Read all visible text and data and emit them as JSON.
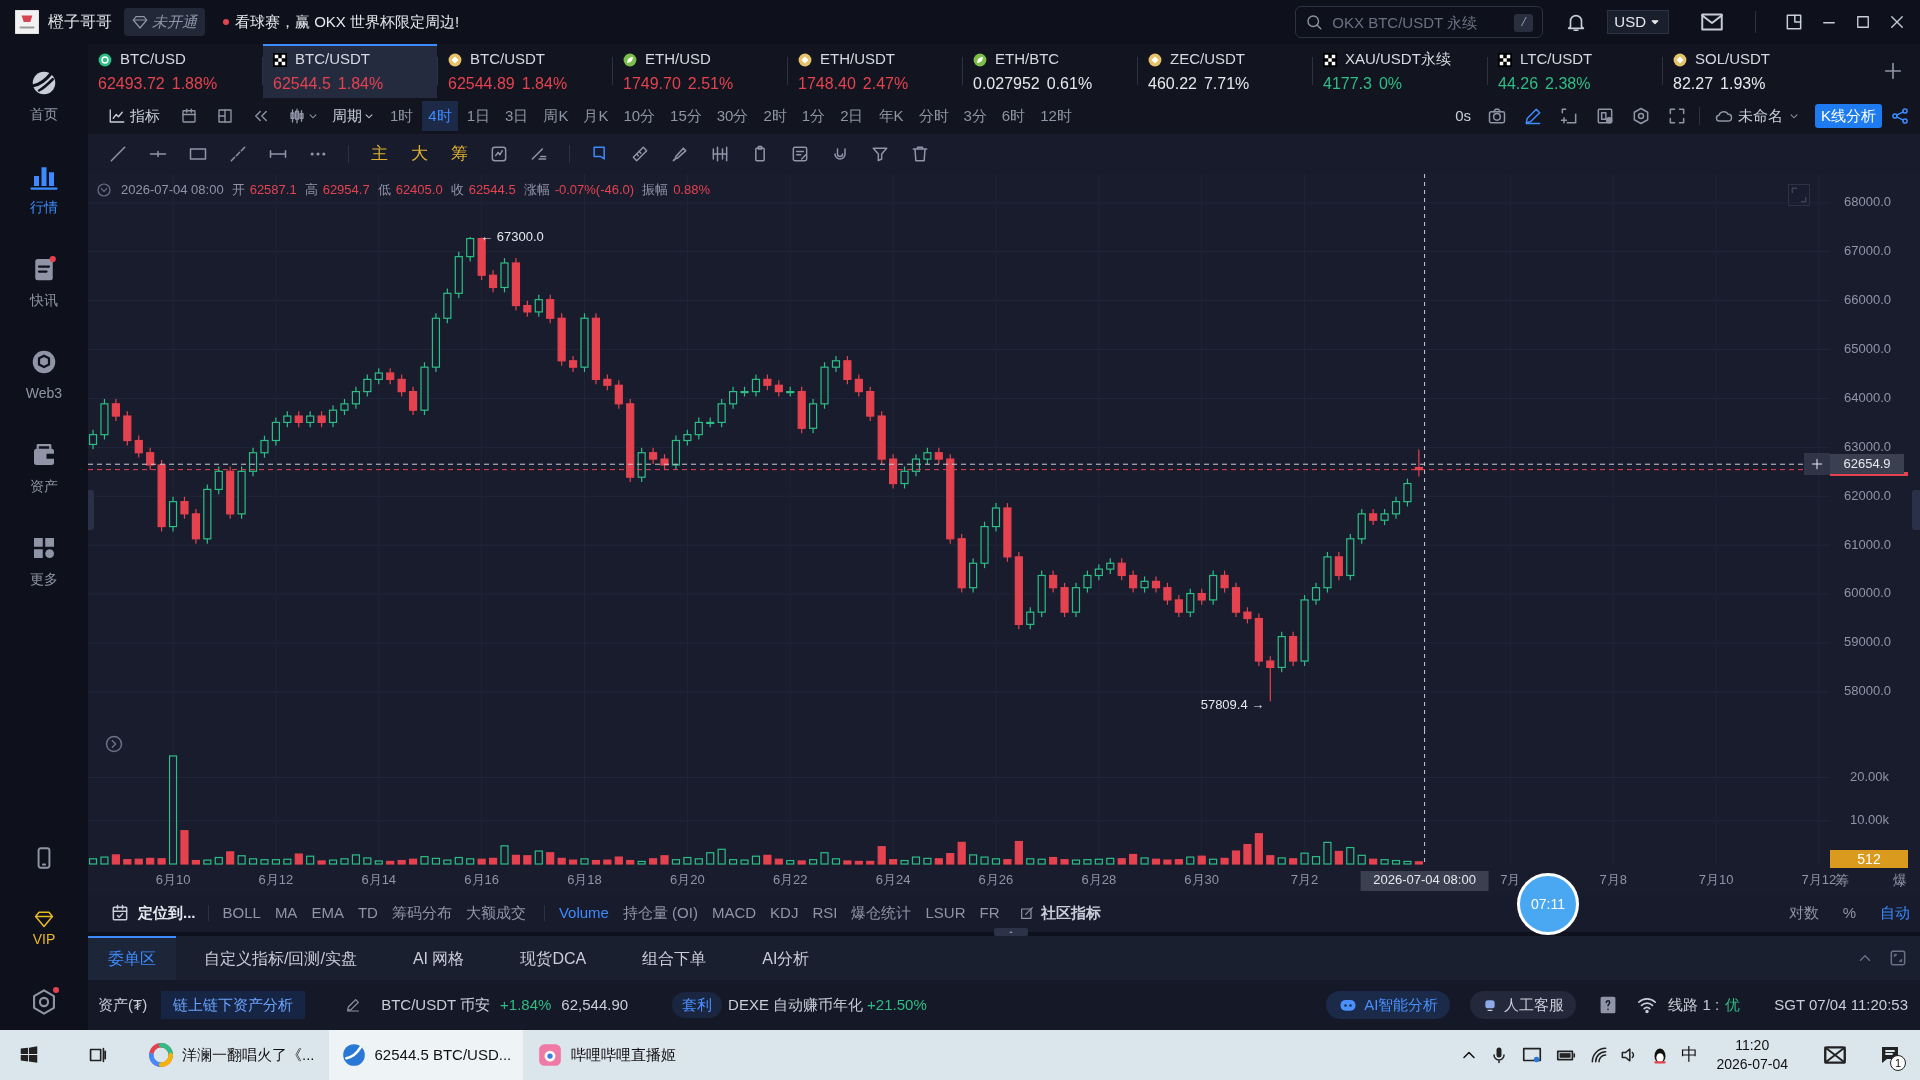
{
  "title_bar": {
    "app_name": "橙子哥哥",
    "membership": "未开通",
    "promo": "看球赛，赢 OKX 世界杯限定周边!",
    "search": {
      "placeholder": "OKX BTC/USDT 永续",
      "shortcut": "/"
    },
    "currency": "USD"
  },
  "sidebar": {
    "items": [
      {
        "label": "首页",
        "kind": "home",
        "selected": false
      },
      {
        "label": "行情",
        "kind": "market",
        "selected": true
      },
      {
        "label": "快讯",
        "kind": "news",
        "selected": false
      },
      {
        "label": "Web3",
        "kind": "web3",
        "selected": false
      },
      {
        "label": "资产",
        "kind": "assets",
        "selected": false
      },
      {
        "label": "更多",
        "kind": "more",
        "selected": false
      }
    ],
    "vip": "VIP"
  },
  "tickers": [
    {
      "symbol": "BTC/USD",
      "kind": "bitcoin",
      "price": "62493.72",
      "change": "1.88%",
      "color": "#e5424f",
      "selected": false
    },
    {
      "symbol": "BTC/USDT",
      "kind": "okx",
      "price": "62544.5",
      "change": "1.84%",
      "color": "#e5424f",
      "selected": true
    },
    {
      "symbol": "BTC/USDT",
      "kind": "binance",
      "price": "62544.89",
      "change": "1.84%",
      "color": "#e5424f",
      "selected": false
    },
    {
      "symbol": "ETH/USD",
      "kind": "leaf",
      "price": "1749.70",
      "change": "2.51%",
      "color": "#e5424f",
      "selected": false
    },
    {
      "symbol": "ETH/USDT",
      "kind": "binance",
      "price": "1748.40",
      "change": "2.47%",
      "color": "#e5424f",
      "selected": false
    },
    {
      "symbol": "ETH/BTC",
      "kind": "leaf",
      "price": "0.027952",
      "change": "0.61%",
      "color": "#e6e8ee",
      "selected": false
    },
    {
      "symbol": "ZEC/USDT",
      "kind": "binance",
      "price": "460.22",
      "change": "7.71%",
      "color": "#e6e8ee",
      "selected": false
    },
    {
      "symbol": "XAU/USDT永续",
      "kind": "okx",
      "price": "4177.3",
      "change": "0%",
      "color": "#2ebd85",
      "selected": false
    },
    {
      "symbol": "LTC/USDT",
      "kind": "okx",
      "price": "44.26",
      "change": "2.38%",
      "color": "#2ebd85",
      "selected": false
    },
    {
      "symbol": "SOL/USDT",
      "kind": "binance",
      "price": "82.27",
      "change": "1.93%",
      "color": "#e6e8ee",
      "selected": false
    }
  ],
  "period_bar": {
    "indicator_button": "指标",
    "period_button": "周期",
    "periods": [
      {
        "label": "1时",
        "selected": false
      },
      {
        "label": "4时",
        "selected": true
      },
      {
        "label": "1日",
        "selected": false
      },
      {
        "label": "3日",
        "selected": false
      },
      {
        "label": "周K",
        "selected": false
      },
      {
        "label": "月K",
        "selected": false
      },
      {
        "label": "10分",
        "selected": false
      },
      {
        "label": "15分",
        "selected": false
      },
      {
        "label": "30分",
        "selected": false
      },
      {
        "label": "2时",
        "selected": false
      },
      {
        "label": "1分",
        "selected": false
      },
      {
        "label": "2日",
        "selected": false
      },
      {
        "label": "年K",
        "selected": false
      },
      {
        "label": "分时",
        "selected": false
      },
      {
        "label": "3分",
        "selected": false
      },
      {
        "label": "6时",
        "selected": false
      },
      {
        "label": "12时",
        "selected": false
      }
    ],
    "timer": "0s",
    "layout_name": "未命名",
    "analysis_button": "K线分析"
  },
  "text_tools": [
    "主",
    "大",
    "筹"
  ],
  "ohlc_info": {
    "time": "2026-07-04 08:00",
    "fields": [
      {
        "label": "开",
        "value": "62587.1"
      },
      {
        "label": "高",
        "value": "62954.7"
      },
      {
        "label": "低",
        "value": "62405.0"
      },
      {
        "label": "收",
        "value": "62544.5"
      },
      {
        "label": "涨幅",
        "value": "-0.07%(-46.0)"
      },
      {
        "label": "振幅",
        "value": "0.88%"
      }
    ]
  },
  "price_chart": {
    "chart_data": {
      "type": "candlestick",
      "grid": true,
      "ylim": [
        57220,
        68590
      ],
      "yticks": [
        {
          "value": 58000,
          "label": "58000.0"
        },
        {
          "value": 59000,
          "label": "59000.0"
        },
        {
          "value": 60000,
          "label": "60000.0"
        },
        {
          "value": 61000,
          "label": "61000.0"
        },
        {
          "value": 62000,
          "label": "62000.0"
        },
        {
          "value": 63000,
          "label": "63000.0"
        },
        {
          "value": 64000,
          "label": "64000.0"
        },
        {
          "value": 65000,
          "label": "65000.0"
        },
        {
          "value": 66000,
          "label": "66000.0"
        },
        {
          "value": 67000,
          "label": "67000.0"
        },
        {
          "value": 68000,
          "label": "68000.0"
        }
      ],
      "ohlc": [
        [
          63060,
          63360,
          62960,
          63260
        ],
        [
          63260,
          63990,
          63160,
          63890
        ],
        [
          63890,
          63990,
          63540,
          63640
        ],
        [
          63640,
          63740,
          63040,
          63140
        ],
        [
          63140,
          63240,
          62790,
          62890
        ],
        [
          62890,
          62990,
          62540,
          62640
        ],
        [
          62640,
          62740,
          61280,
          61380
        ],
        [
          61380,
          61990,
          61280,
          61890
        ],
        [
          61890,
          61990,
          61540,
          61640
        ],
        [
          61640,
          61740,
          61030,
          61130
        ],
        [
          61130,
          62240,
          61030,
          62140
        ],
        [
          62140,
          62610,
          62040,
          62510
        ],
        [
          62510,
          62610,
          61540,
          61640
        ],
        [
          61640,
          62610,
          61540,
          62510
        ],
        [
          62510,
          62990,
          62410,
          62890
        ],
        [
          62890,
          63240,
          62790,
          63140
        ],
        [
          63140,
          63610,
          63040,
          63510
        ],
        [
          63510,
          63740,
          63410,
          63640
        ],
        [
          63640,
          63740,
          63410,
          63510
        ],
        [
          63510,
          63740,
          63410,
          63640
        ],
        [
          63640,
          63740,
          63410,
          63510
        ],
        [
          63510,
          63860,
          63410,
          63760
        ],
        [
          63760,
          63990,
          63660,
          63890
        ],
        [
          63890,
          64240,
          63790,
          64140
        ],
        [
          64140,
          64490,
          64040,
          64390
        ],
        [
          64390,
          64620,
          64290,
          64520
        ],
        [
          64520,
          64620,
          64290,
          64390
        ],
        [
          64390,
          64490,
          64040,
          64140
        ],
        [
          64140,
          64240,
          63660,
          63760
        ],
        [
          63760,
          64740,
          63660,
          64640
        ],
        [
          64640,
          65740,
          64540,
          65640
        ],
        [
          65640,
          66250,
          65540,
          66150
        ],
        [
          66150,
          67000,
          66050,
          66900
        ],
        [
          66900,
          67300,
          66800,
          67270
        ],
        [
          67270,
          67290,
          66420,
          66520
        ],
        [
          66520,
          66620,
          66170,
          66270
        ],
        [
          66270,
          66870,
          66170,
          66770
        ],
        [
          66770,
          66870,
          65800,
          65900
        ],
        [
          65900,
          66000,
          65670,
          65770
        ],
        [
          65770,
          66120,
          65670,
          66020
        ],
        [
          66020,
          66120,
          65540,
          65640
        ],
        [
          65640,
          65740,
          64670,
          64770
        ],
        [
          64770,
          64870,
          64540,
          64640
        ],
        [
          64640,
          65740,
          64540,
          65640
        ],
        [
          65640,
          65740,
          64290,
          64390
        ],
        [
          64390,
          64490,
          64170,
          64270
        ],
        [
          64270,
          64370,
          63790,
          63890
        ],
        [
          63890,
          63990,
          62290,
          62390
        ],
        [
          62390,
          62990,
          62290,
          62890
        ],
        [
          62890,
          62990,
          62660,
          62760
        ],
        [
          62760,
          62860,
          62540,
          62640
        ],
        [
          62640,
          63240,
          62540,
          63140
        ],
        [
          63140,
          63360,
          63040,
          63260
        ],
        [
          63260,
          63610,
          63160,
          63510
        ],
        [
          63510,
          63610,
          63410,
          63510
        ],
        [
          63510,
          63990,
          63410,
          63890
        ],
        [
          63890,
          64240,
          63790,
          64140
        ],
        [
          64140,
          64240,
          64040,
          64140
        ],
        [
          64140,
          64490,
          64040,
          64390
        ],
        [
          64390,
          64490,
          64170,
          64270
        ],
        [
          64270,
          64370,
          64040,
          64140
        ],
        [
          64140,
          64240,
          64040,
          64140
        ],
        [
          64140,
          64240,
          63290,
          63390
        ],
        [
          63390,
          63990,
          63290,
          63890
        ],
        [
          63890,
          64740,
          63790,
          64640
        ],
        [
          64640,
          64870,
          64540,
          64770
        ],
        [
          64770,
          64870,
          64290,
          64390
        ],
        [
          64390,
          64490,
          64040,
          64140
        ],
        [
          64140,
          64240,
          63540,
          63640
        ],
        [
          63640,
          63740,
          62660,
          62760
        ],
        [
          62760,
          62860,
          62160,
          62260
        ],
        [
          62260,
          62610,
          62160,
          62510
        ],
        [
          62510,
          62860,
          62410,
          62760
        ],
        [
          62760,
          62990,
          62660,
          62890
        ],
        [
          62890,
          62990,
          62660,
          62760
        ],
        [
          62760,
          62860,
          61030,
          61130
        ],
        [
          61130,
          61230,
          60030,
          60130
        ],
        [
          60130,
          60730,
          60030,
          60630
        ],
        [
          60630,
          61480,
          60530,
          61380
        ],
        [
          61380,
          61860,
          61280,
          61760
        ],
        [
          61760,
          61860,
          60660,
          60760
        ],
        [
          60760,
          60860,
          59280,
          59380
        ],
        [
          59380,
          59730,
          59280,
          59630
        ],
        [
          59630,
          60480,
          59530,
          60380
        ],
        [
          60380,
          60480,
          60030,
          60130
        ],
        [
          60130,
          60230,
          59530,
          59630
        ],
        [
          59630,
          60230,
          59530,
          60130
        ],
        [
          60130,
          60480,
          60030,
          60380
        ],
        [
          60380,
          60610,
          60280,
          60510
        ],
        [
          60510,
          60730,
          60410,
          60630
        ],
        [
          60630,
          60730,
          60280,
          60380
        ],
        [
          60380,
          60480,
          60030,
          60130
        ],
        [
          60130,
          60360,
          60030,
          60260
        ],
        [
          60260,
          60360,
          60030,
          60130
        ],
        [
          60130,
          60230,
          59780,
          59880
        ],
        [
          59880,
          59980,
          59530,
          59630
        ],
        [
          59630,
          60110,
          59530,
          60010
        ],
        [
          60010,
          60110,
          59780,
          59880
        ],
        [
          59880,
          60480,
          59780,
          60380
        ],
        [
          60380,
          60480,
          60030,
          60130
        ],
        [
          60130,
          60230,
          59530,
          59630
        ],
        [
          59630,
          59730,
          59400,
          59500
        ],
        [
          59500,
          59600,
          58530,
          58630
        ],
        [
          58630,
          58730,
          57809.4,
          58500
        ],
        [
          58500,
          59230,
          58400,
          59130
        ],
        [
          59130,
          59230,
          58530,
          58630
        ],
        [
          58630,
          59980,
          58530,
          59880
        ],
        [
          59880,
          60230,
          59780,
          60130
        ],
        [
          60130,
          60860,
          60030,
          60760
        ],
        [
          60760,
          60860,
          60280,
          60380
        ],
        [
          60380,
          61230,
          60280,
          61130
        ],
        [
          61130,
          61740,
          61030,
          61640
        ],
        [
          61640,
          61740,
          61410,
          61510
        ],
        [
          61510,
          61740,
          61410,
          61640
        ],
        [
          61640,
          61990,
          61540,
          61890
        ],
        [
          61890,
          62360,
          61790,
          62260
        ],
        [
          62587.1,
          62954.7,
          62405,
          62544.5
        ],
        null,
        null,
        null,
        null,
        null,
        null,
        null,
        null,
        null,
        null,
        null,
        null,
        null,
        null,
        null,
        null,
        null,
        null,
        null,
        null,
        null,
        null,
        null,
        null,
        null,
        null,
        null,
        null,
        null,
        null,
        null,
        null,
        null,
        null,
        null
      ],
      "ref_lines": [
        {
          "axis": "y",
          "value": 62544.5,
          "color": "#e5424f"
        },
        {
          "axis": "y",
          "value": 62654.9,
          "color": "#c9cdd8"
        }
      ],
      "annotations": [
        "← 67300.0",
        "57809.4 →"
      ]
    },
    "crosshair_price": "62654.9"
  },
  "volume_chart": {
    "chart_data": {
      "type": "bar",
      "grid": true,
      "ylim": [
        0,
        31
      ],
      "categories": [
        null,
        null,
        null,
        null,
        null,
        null,
        null,
        "6月10",
        null,
        null,
        null,
        null,
        null,
        null,
        null,
        null,
        "6月12",
        null,
        null,
        null,
        null,
        null,
        null,
        null,
        null,
        "6月14",
        null,
        null,
        null,
        null,
        null,
        null,
        null,
        null,
        "6月16",
        null,
        null,
        null,
        null,
        null,
        null,
        null,
        null,
        "6月18",
        null,
        null,
        null,
        null,
        null,
        null,
        null,
        null,
        "6月20",
        null,
        null,
        null,
        null,
        null,
        null,
        null,
        null,
        "6月22",
        null,
        null,
        null,
        null,
        null,
        null,
        null,
        null,
        "6月24",
        null,
        null,
        null,
        null,
        null,
        null,
        null,
        null,
        "6月26",
        null,
        null,
        null,
        null,
        null,
        null,
        null,
        null,
        "6月28",
        null,
        null,
        null,
        null,
        null,
        null,
        null,
        null,
        "6月30",
        null,
        null,
        null,
        null,
        null,
        null,
        null,
        null,
        "7月2",
        null,
        null,
        null,
        null,
        null,
        null,
        null,
        null,
        null,
        null,
        null,
        null,
        null,
        null,
        null,
        null,
        null,
        "7月",
        null,
        null,
        null,
        null,
        null,
        null,
        null,
        null,
        "7月8",
        null,
        null,
        null,
        null,
        null,
        null,
        null,
        null,
        "7月10",
        null,
        null,
        null,
        null,
        null,
        null,
        null,
        null,
        "7月12"
      ],
      "yticks": [
        {
          "value": 10,
          "label": "10.00k"
        },
        {
          "value": 20,
          "label": "20.00k"
        }
      ],
      "values": [
        1.2,
        1.6,
        2.1,
        1.0,
        1.1,
        1.3,
        1.2,
        25.0,
        7.7,
        0.8,
        0.9,
        1.5,
        2.8,
        1.9,
        1.2,
        1.0,
        1.0,
        1.1,
        2.3,
        1.8,
        0.7,
        0.9,
        1.2,
        2.1,
        1.4,
        0.7,
        0.6,
        0.8,
        1.1,
        1.7,
        1.3,
        0.9,
        1.5,
        1.2,
        1.1,
        1.3,
        4.2,
        2.0,
        1.9,
        3.0,
        2.6,
        1.3,
        0.9,
        1.2,
        0.8,
        0.9,
        1.6,
        0.8,
        0.6,
        1.2,
        1.9,
        1.0,
        1.5,
        1.2,
        2.6,
        3.4,
        1.0,
        0.9,
        1.8,
        2.0,
        1.1,
        0.8,
        0.7,
        1.0,
        2.6,
        1.2,
        0.7,
        0.6,
        0.6,
        4.0,
        1.0,
        0.8,
        1.6,
        1.3,
        1.2,
        2.4,
        5.0,
        2.1,
        1.6,
        1.2,
        1.0,
        5.2,
        1.2,
        1.1,
        1.5,
        1.0,
        0.9,
        1.0,
        1.1,
        1.3,
        1.2,
        2.2,
        1.4,
        1.1,
        0.9,
        1.0,
        1.6,
        1.8,
        1.1,
        1.3,
        3.0,
        4.5,
        7.0,
        1.9,
        1.4,
        1.2,
        2.5,
        1.7,
        5.0,
        2.9,
        3.8,
        2.0,
        1.1,
        1.0,
        0.8,
        0.6,
        0.5,
        null,
        null,
        null,
        null,
        null,
        null,
        null,
        null,
        null,
        null,
        null,
        null,
        null,
        null,
        null,
        null,
        null,
        null,
        null,
        null,
        null,
        null,
        null,
        null,
        null,
        null,
        null,
        null,
        null,
        null,
        null,
        null,
        null,
        null,
        null
      ]
    },
    "current_volume": "512",
    "crosshair_time": "2026-07-04 08:00",
    "axis_buttons": [
      "筹",
      "爆"
    ]
  },
  "clock_bubble": "07:11",
  "indicator_bar": {
    "locate_button": "定位到...",
    "main_indicators": [
      "BOLL",
      "MA",
      "EMA",
      "TD",
      "筹码分布",
      "大额成交"
    ],
    "sub_indicators": [
      {
        "label": "Volume",
        "selected": true
      },
      {
        "label": "持仓量 (OI)",
        "selected": false
      },
      {
        "label": "MACD",
        "selected": false
      },
      {
        "label": "KDJ",
        "selected": false
      },
      {
        "label": "RSI",
        "selected": false
      },
      {
        "label": "爆仓统计",
        "selected": false
      },
      {
        "label": "LSUR",
        "selected": false
      },
      {
        "label": "FR",
        "selected": false
      }
    ],
    "community_button": "社区指标",
    "scale_modes": [
      {
        "label": "对数",
        "selected": false
      },
      {
        "label": "%",
        "selected": false
      },
      {
        "label": "自动",
        "selected": true
      }
    ]
  },
  "bottom_tabs": [
    {
      "label": "委单区",
      "selected": true
    },
    {
      "label": "自定义指标/回测/实盘",
      "selected": false
    },
    {
      "label": "AI 网格",
      "selected": false
    },
    {
      "label": "现货DCA",
      "selected": false
    },
    {
      "label": "组合下单",
      "selected": false
    },
    {
      "label": "AI分析",
      "selected": false
    }
  ],
  "status_bar": {
    "assets_label": "资产(₮)",
    "analysis_button": "链上链下资产分析",
    "pair": "BTC/USDT 币安",
    "pair_change": "+1.84%",
    "pair_price": "62,544.90",
    "tag": "套利",
    "product": "DEXE 自动赚币年化",
    "product_yield": "+21.50%",
    "ai_button": "AI智能分析",
    "support_button": "人工客服",
    "line_label": "线路 1 :",
    "line_quality": "优",
    "clock": "SGT 07/04 11:20:53"
  },
  "taskbar": {
    "apps": [
      {
        "label": "洋澜一翻唱火了《...",
        "kind": "ring",
        "selected": false
      },
      {
        "label": "62544.5 BTC/USD...",
        "kind": "globe",
        "selected": true
      },
      {
        "label": "哔哩哔哩直播姬",
        "kind": "tv",
        "selected": false
      }
    ],
    "ime": "中",
    "time": "11:20",
    "date": "2026-07-04",
    "notifications": "1"
  }
}
